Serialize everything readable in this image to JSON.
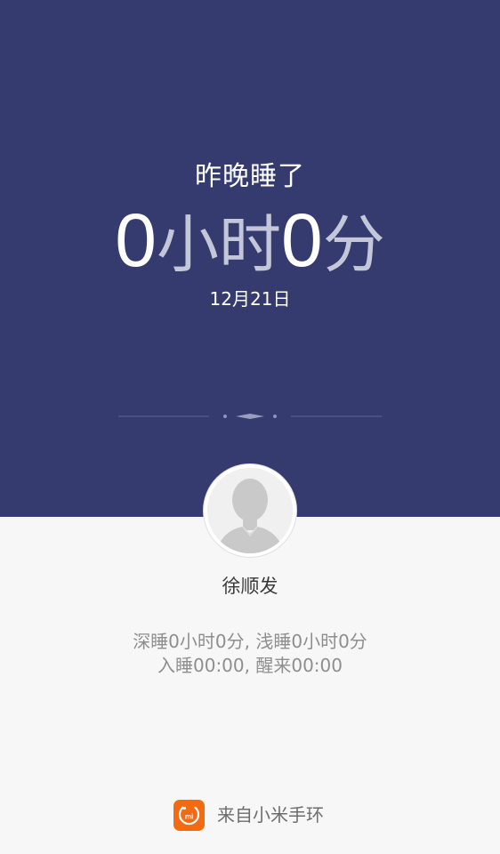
{
  "hero": {
    "subtitle": "昨晚睡了",
    "hours": "0",
    "hours_unit": "小时",
    "minutes": "0",
    "minutes_unit": "分",
    "date": "12月21日"
  },
  "user": {
    "name": "徐顺发",
    "avatar_icon": "default-user-avatar-icon"
  },
  "stats": {
    "line1": "深睡0小时0分, 浅睡0小时0分",
    "line2": "入睡00:00, 醒来00:00"
  },
  "footer": {
    "source_label": "来自小米手环",
    "logo_icon": "mi-band-app-icon",
    "logo_text": "mi"
  },
  "colors": {
    "hero_background": "#353b6f",
    "page_background": "#f7f7f7",
    "brand_orange": "#f36a13"
  }
}
